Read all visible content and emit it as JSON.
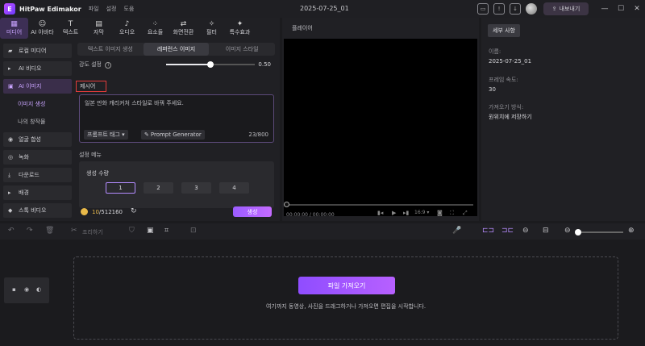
{
  "app": {
    "name": "HitPaw Edimakor",
    "menu": [
      "파일",
      "설정",
      "도움"
    ],
    "doc_title": "2025-07-25_01",
    "export_label": "내보내기"
  },
  "top_tabs": [
    {
      "label": "미디어",
      "icon": "media-icon"
    },
    {
      "label": "AI 아바타",
      "icon": "avatar-icon"
    },
    {
      "label": "텍스트",
      "icon": "text-icon"
    },
    {
      "label": "자막",
      "icon": "subtitle-icon"
    },
    {
      "label": "오디오",
      "icon": "audio-icon"
    },
    {
      "label": "요소들",
      "icon": "elements-icon"
    },
    {
      "label": "화면전환",
      "icon": "transition-icon"
    },
    {
      "label": "필터",
      "icon": "filter-icon"
    },
    {
      "label": "특수효과",
      "icon": "effects-icon"
    }
  ],
  "side_nav": {
    "my_media": "로컬 미디어",
    "ai_video": "AI 비디오",
    "ai_image": "AI 이미지",
    "image_gen": "이미지 생성",
    "my_works": "나의 창작물",
    "face_swap": "얼굴 합성",
    "record": "녹화",
    "download": "다운로드",
    "background": "배경",
    "stock_video": "스톡 비디오"
  },
  "sub_tabs": [
    "텍스트 이미지 생성",
    "레퍼런스 이미지",
    "이미지 스타일"
  ],
  "strength": {
    "label": "강도 설정",
    "value": "0.50",
    "level": 0.5
  },
  "prompt": {
    "label": "제시어",
    "text": "일본 만화 캐리커처 스타일로 바꿔 주세요.",
    "tag_label": "프롬프트 태그 ▾",
    "generator_label": "Prompt Generator",
    "count": "23/800"
  },
  "settings": {
    "title": "설정 메뉴",
    "gen_count_label": "생성 수량",
    "options": [
      "1",
      "2",
      "3",
      "4"
    ]
  },
  "credits": {
    "current": "10",
    "total": "/512160"
  },
  "generate_label": "생성",
  "player": {
    "title": "플레이어",
    "time": "00:00:00 / 00:00:00",
    "ratio": "16:9 ▾"
  },
  "right_panel": {
    "tab": "세부 사항",
    "name_label": "이름:",
    "name_value": "2025-07-25_01",
    "fps_label": "프레임 속도:",
    "fps_value": "30",
    "save_label": "가져오기 방식:",
    "save_value": "원위치에 저장하기"
  },
  "timeline_toolbar": {
    "audio_label": "조리하기"
  },
  "timeline": {
    "import_label": "파일 가져오기",
    "hint": "여기까지 동영상, 사진을 드래그하거나 가져오면 편집을 시작합니다."
  },
  "colors": {
    "accent": "#b48cff",
    "generate": "#9b5cff",
    "highlight_box": "#e23b3b"
  }
}
